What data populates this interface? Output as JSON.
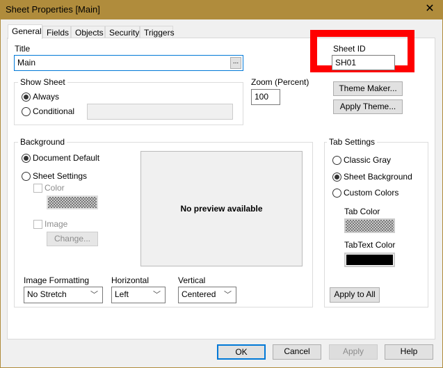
{
  "window": {
    "title": "Sheet Properties [Main]",
    "close": "✕"
  },
  "tabs": [
    "General",
    "Fields",
    "Objects",
    "Security",
    "Triggers"
  ],
  "general": {
    "title_label": "Title",
    "title_value": "Main",
    "ellipsis": "...",
    "sheet_id_label": "Sheet ID",
    "sheet_id_value": "SH01",
    "show_sheet": {
      "label": "Show Sheet",
      "always": "Always",
      "conditional": "Conditional",
      "selected": "Always"
    },
    "zoom": {
      "label": "Zoom (Percent)",
      "value": "100"
    },
    "theme_maker": "Theme Maker...",
    "apply_theme": "Apply Theme...",
    "background": {
      "label": "Background",
      "document_default": "Document Default",
      "sheet_settings": "Sheet Settings",
      "color": "Color",
      "image": "Image",
      "change": "Change...",
      "preview": "No preview available",
      "selected": "Document Default"
    },
    "image_formatting": {
      "label": "Image Formatting",
      "value": "No Stretch"
    },
    "horizontal": {
      "label": "Horizontal",
      "value": "Left"
    },
    "vertical": {
      "label": "Vertical",
      "value": "Centered"
    },
    "tab_settings": {
      "label": "Tab Settings",
      "classic_gray": "Classic Gray",
      "sheet_background": "Sheet Background",
      "custom_colors": "Custom Colors",
      "tab_color": "Tab Color",
      "tabtext_color": "TabText Color",
      "apply_all": "Apply to All",
      "selected": "Sheet Background"
    }
  },
  "footer": {
    "ok": "OK",
    "cancel": "Cancel",
    "apply": "Apply",
    "help": "Help"
  },
  "colors": {
    "titlebar": "#b08c3c",
    "highlight": "#ff0000",
    "focus": "#0078d7"
  }
}
